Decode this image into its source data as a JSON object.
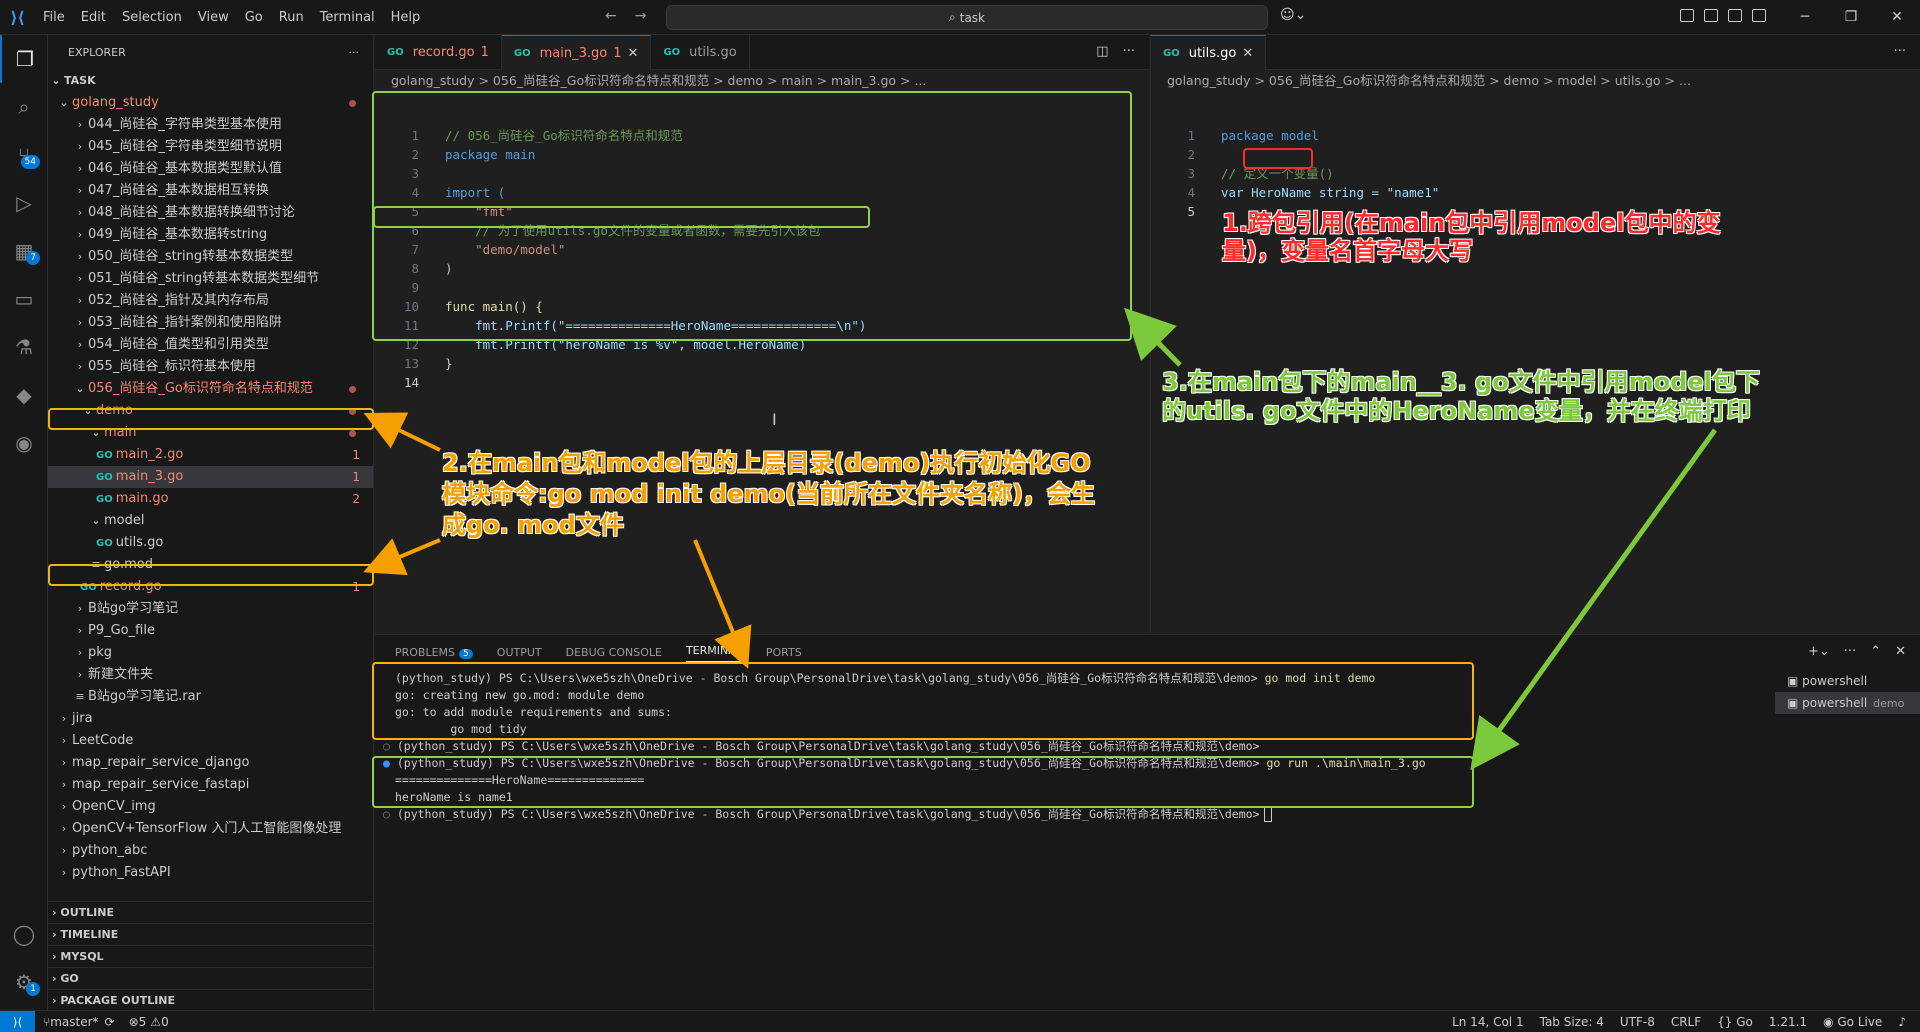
{
  "menu": [
    "File",
    "Edit",
    "Selection",
    "View",
    "Go",
    "Run",
    "Terminal",
    "Help"
  ],
  "command_center": "task",
  "sidebar": {
    "title": "EXPLORER",
    "root": "TASK",
    "project": "golang_study",
    "items": [
      "044_尚硅谷_字符串类型基本使用",
      "045_尚硅谷_字符串类型细节说明",
      "046_尚硅谷_基本数据类型默认值",
      "047_尚硅谷_基本数据相互转换",
      "048_尚硅谷_基本数据转换细节讨论",
      "049_尚硅谷_基本数据转string",
      "050_尚硅谷_string转基本数据类型",
      "051_尚硅谷_string转基本数据类型细节",
      "052_尚硅谷_指针及其内存布局",
      "053_尚硅谷_指针案例和使用陷阱",
      "054_尚硅谷_值类型和引用类型",
      "055_尚硅谷_标识符基本使用"
    ],
    "open_folder": "056_尚硅谷_Go标识符命名特点和规范",
    "demo": "demo",
    "main": "main",
    "main_files": [
      {
        "name": "main_2.go",
        "count": "1"
      },
      {
        "name": "main_3.go",
        "count": "1"
      },
      {
        "name": "main.go",
        "count": "2"
      }
    ],
    "model": "model",
    "utils": "utils.go",
    "gomod": "go.mod",
    "record": "record.go",
    "record_count": "1",
    "others": [
      "B站go学习笔记",
      "P9_Go_file",
      "pkg",
      "新建文件夹"
    ],
    "rar": "B站go学习笔记.rar",
    "root_items": [
      "jira",
      "LeetCode",
      "map_repair_service_django",
      "map_repair_service_fastapi",
      "OpenCV_img",
      "OpenCV+TensorFlow 入门人工智能图像处理",
      "python_abc",
      "python_FastAPI"
    ],
    "sections": [
      "OUTLINE",
      "TIMELINE",
      "MYSQL",
      "GO",
      "PACKAGE OUTLINE"
    ]
  },
  "activity_badges": {
    "source_control": "54",
    "extensions": "7",
    "settings": "1"
  },
  "editor_left": {
    "tabs": [
      {
        "name": "record.go",
        "extra": "1"
      },
      {
        "name": "main_3.go",
        "extra": "1"
      },
      {
        "name": "utils.go",
        "extra": ""
      }
    ],
    "breadcrumb": "golang_study > 056_尚硅谷_Go标识符命名特点和规范 > demo > main > main_3.go > ...",
    "code": [
      "// 056_尚硅谷_Go标识符命名特点和规范",
      "package main",
      "",
      "import (",
      "    \"fmt\"",
      "    // 为了使用utils.go文件的变量或者函数，需要先引入该包",
      "    \"demo/model\"",
      ")",
      "",
      "func main() {",
      "    fmt.Printf(\"==============HeroName==============\\n\")",
      "    fmt.Printf(\"heroName is %v\", model.HeroName)",
      "}",
      ""
    ]
  },
  "editor_right": {
    "tab": "utils.go",
    "breadcrumb": "golang_study > 056_尚硅谷_Go标识符命名特点和规范 > demo > model > utils.go > ...",
    "code": [
      "package model",
      "",
      "// 定义一个变量()",
      "var HeroName string = \"name1\"",
      ""
    ]
  },
  "panel": {
    "tabs": [
      "PROBLEMS",
      "OUTPUT",
      "DEBUG CONSOLE",
      "TERMINAL",
      "PORTS"
    ],
    "problems_count": "5",
    "prompt": "(python_study) PS C:\\Users\\wxe5szh\\OneDrive - Bosch Group\\PersonalDrive\\task\\golang_study\\056_尚硅谷_Go标识符命名特点和规范\\demo>",
    "cmd1": "go mod init demo",
    "out1": [
      "go: creating new go.mod: module demo",
      "go: to add module requirements and sums:",
      "        go mod tidy"
    ],
    "cmd2": "go run .\\main\\main_3.go",
    "out2": [
      "==============HeroName==============",
      "heroName is name1"
    ],
    "terminals": [
      {
        "name": "powershell",
        "sub": ""
      },
      {
        "name": "powershell",
        "sub": "demo"
      }
    ]
  },
  "annotations": {
    "a1": "1.跨包引用(在main包中引用model包中的变量)，变量名首字母大写",
    "a2": "2.在main包和model包的上层目录(demo)执行初始化GO模块命令:go  mod  init  demo(当前所在文件夹名称)，会生成go. mod文件",
    "a3": "3.在main包下的main__3. go文件中引用model包下的utils. go文件中的HeroName变量，并在终端打印",
    "colors": {
      "red": "#ff2a2a",
      "orange": "#f5a000",
      "green": "#7dc93c"
    }
  },
  "statusbar": {
    "branch": "master*",
    "errors": "5",
    "warnings": "0",
    "position": "Ln 14, Col 1",
    "tab_size": "Tab Size: 4",
    "encoding": "UTF-8",
    "eol": "CRLF",
    "lang": "Go",
    "version": "1.21.1",
    "golive": "Go Live"
  }
}
